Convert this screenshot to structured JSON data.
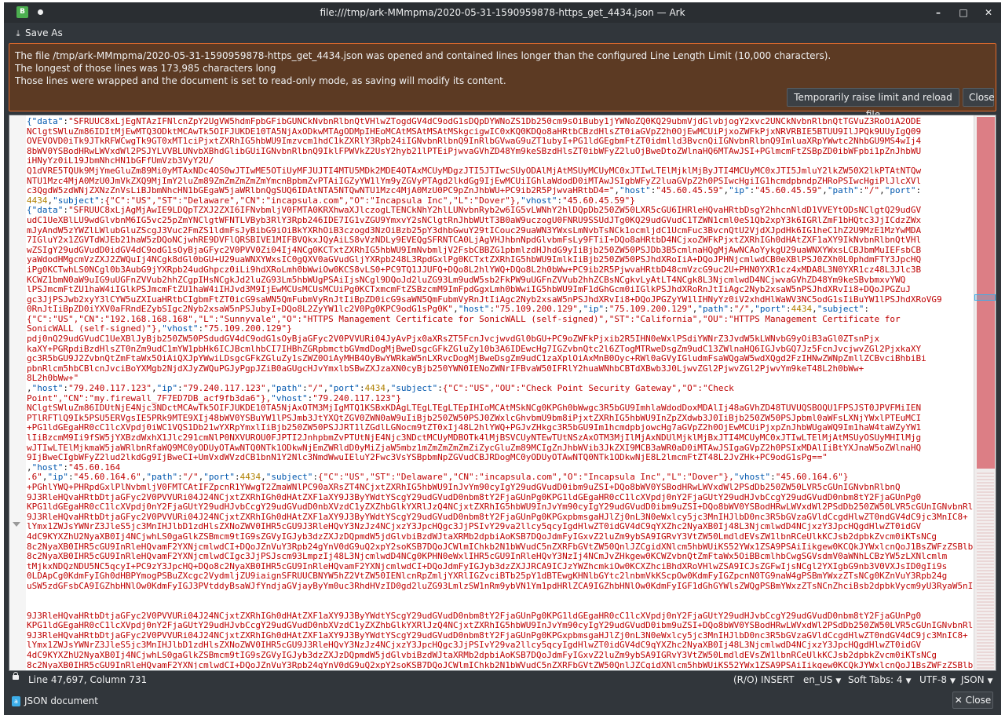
{
  "window": {
    "title": "file:///tmp/ark-MMmpma/2020-05-31-1590959878-https_get_4434.json — Ark",
    "app_icon": "B",
    "buttons": {
      "minimize": "–",
      "maximize": "□",
      "close": "✕"
    }
  },
  "toolbar": {
    "save_as": "Save As",
    "save_as_icon": "save-as-icon"
  },
  "banner": {
    "lines": [
      "The file /tmp/ark-MMmpma/2020-05-31-1590959878-https_get_4434.json was opened and contained lines longer than the configured Line Length Limit (10,000 characters).",
      "The longest of those lines was 173,985 characters long",
      "Those lines were wrapped and the document is set to read-only mode, as saving will modify its content."
    ],
    "reload_button": "Temporarily raise limit and reload file",
    "close_button": "Close",
    "colors": {
      "background": "#5c3a23",
      "border": "#e06a2c"
    }
  },
  "editor": {
    "lines": [
      [
        "{\"data\"",
        ":",
        "\"SFRUUC8xLjEgNTAzIFNlcnZpY2UgVW5hdmFpbGFibGUNCkNvbnRlbnQtVHlwZTogdGV4dC9odG1sDQpDYWNoZS1Db250cm9sOiBuby1jYWNoZQ0KQ29ubmVjdGlvbjogY2xvc2UNCkNvbnRlbnQtTGVuZ3RoOiA2ODE"
      ],
      [
        "",
        "",
        "NClgtSWluZm86IDItMjEwMTQ3ODktMCAwTk5OIFJUKDE10TA5NjAxODkwMTAgODMpIHEoMCAtMSAtMSAtMSkgcigwIC0xKQ0KDQo8aHRtbCBzdHlsZT0iaGVpZ2h0OjEwMCUiPjxoZWFkPjxNRVRBIE5BTUU9IlJPQk9UUyIgQ09"
      ],
      [
        "",
        "",
        "OVEVOVD0iTk9JTkRFWCwgTk9GT0xMT1ciPjxtZXRhIG5hbWU9Imzvcm1hdC1kZXRlY3Rpb24iIGNvbnRlbnQ9InRlbGVwaG9uZT1ubyI+PG1ldGEgbmFtZT0idmlld3BvcnQiIGNvbnRlbnQ9ImluaXRpYWwtc2NhbGU9MS4wIj4"
      ],
      [
        "",
        "",
        "8bWV0YSBodHRwLWVxdWl2PSJYLVVBLUNvbXBhdGlibGUiIGNvbnRlbnQ9IklFPWVkZ2UsY2hyb21lPTEiPjwvaGVhZD48Ym9keSBzdHlsZT0ibWFyZ2luOjBweDtoZWlnaHQ6MTAwJSI+PGlmcmFtZSBpZD0ibWFpbi1pZnJhbWU"
      ],
      [
        "",
        "",
        "iHNyYz0iL19JbmNhcHN1bGFfUmVzb3VyY2U/"
      ],
      [
        "",
        "",
        "Q1dVRE5TQUk9MjYmeGluZm89Mi0yMTAxNDc4OS0wJTIwME5OTiUyMFJUJTI4MTU5MDk2MDE4OTAxMCUyMDgzJTI5JTIwcSUyODAlMjAtMSUyMCUyMC0xJTIwLTElMjklMjByJTI4MCUyMC0xJTI5JmluY2lkZW50X2lkPTAtNTQw"
      ],
      [
        "",
        "",
        "NTU1Mzc4MjA0MzU0JmVkZXQ9MjImY2luZm89ZmZmZmZmZmYmcnBpbmZvPTAiIGZyYW1lYm9yZGVyPTAgd2lkdGg9IjEwMCUiIGhlaWdodD0iMTAwJSIgbWFyZ2luaGVpZ2h0PSIwcHgiIG1hcmdpbndpZHRoPSIwcHgiPlJlcXVl"
      ],
      [
        "",
        "",
        "c3QgdW5zdWNjZXNzZnVsLiBJbmNhcHN1bGEgaW5jaWRlbnQgSUQ6IDAtNTA5NTQwNTU1Mzc4MjA0MzU0PC9pZnJhbWU+PC9ib2R5PjwvaHRtbD4=\"",
        ",",
        ""
      ],
      [
        "",
        "",
        ""
      ],
      [
        "",
        "",
        ""
      ],
      [
        "{\"data\"",
        ":",
        "\"SFRUUC8xLjAgMjAwIE9LDQpTZXJ2ZXI6IFNvbmljV0FMTA0KRXhwaXJlczogLTENCkNhY2hlLUNvbnRyb2w6IG5vLWNhY2hlDQpDb250ZW50LXR5cGU6IHRleHQvaHRtbDsgY2hhcnNldD1VVEYtODsNClgtQ29udGV"
      ],
      [
        "",
        "",
        "udC1UeXBlLU9wdGlvbnM6IG5vc25pZmYNClgtWFNTLVByb3RlY3Rpb246IDE7IG1vZGU9YmxvY2sNClgtRnJhbWUtT3B0aW9uczogU0FNRU9SSUdJTg0KQ29udGVudC1TZWN1cml0eS1Qb2xpY3k6IGRlZmF1bHQtc3JjICdzZWx"
      ],
      [
        "",
        "",
        "mJyAndW5zYWZlLWlubGluZScgJ3Vuc2FmZS1ldmFsJyBibG9iOiBkYXRhOiB3czogd3NzOiBzb25pY3dhbGwuY29tICouc29uaWN3YWxsLmNvbTsNCk1ocmljdC1UcmFuc3BvcnQtU2VjdXJpdHk6IG1heC1hZ2U9MzE1MzYwMDA"
      ],
      [
        "",
        "",
        "7IGluY2x1ZGVTdWJEb21haW5zDQoNCjwhRE9DVFlQRSBIVE1MIFBVQkxJQyAiLS8vVzNDLy9EVEQgSFRNTCA0LjAgVHJhbnNpdGlvbmFsLy9FTiI+DQo8aHRtbD4NCjxoZWFkPjxtZXRhIGh0dHAtZXF1aXY9IkNvbnRlbnQtVHl"
      ],
      [
        "",
        "",
        "wZSIgY29udGVudD0idGV4dC9odG1sOyBjaGFyc2V0PVV0Zi04Ij4NCg0KCTxtZXRhIG5hbWU9ImNvbmljV2FsbCBBZG1pbmlzdHJhdG9yIiBjb250ZW50PSJDb3B5cmlnaHQgMjAwNCAoYykgU29uaWNXYWxsLCBJbmMuIEFsbCB"
      ],
      [
        "",
        "",
        "yaWdodHMgcmVzZXJ2ZWQuIj4NCgk8dGl0bGU+U29uaWNXYWxsIC0gQXV0aGVudGljYXRpb248L3RpdGxlPg0KCTxtZXRhIG5hbWU9ImlkIiBjb250ZW50PSJhdXRoIiA+DQoJPHNjcmlwdCB0eXBlPSJ0ZXh0L0phdmFTY3JpcHQ"
      ],
      [
        "",
        "",
        "iPg0KCTwhLS0NCgl0b3AubG9jYXRpb24udGhpcz0iLi9hdXRoLmh0bWwiOw0KCS8vLS0+PC9TQ1JJUFQ+DQo8L2hlYWQ+DQo8L2h0bWw+PC9ib2R5PjwvaHRtbD48cmVzcG9uc2U+PHN0YXR1cz4xMDA8L3N0YXR1cz48L3Jlc3B"
      ],
      [
        "",
        "",
        "KCWZ1bmN0aW9uIG9uUGFnZVVub2hhZCgpIHsNCgkJd2luZG93Lm5hbWUgPSAiIjsNCgl9DQoJd2luZG93Lm9udW5sb2FkPW9uUGFnZVVub2hhZCBsNCgkvLyAtLT4NCgk8L3NjcmlwdD4NCjwvaGVhZD48Ym9keSBvbmxvYWQ"
      ],
      [
        "",
        "",
        "lPSJmcmFtZU1haW4iIGlkPSJmcmFtZU1haW4iIHJvd3M9IjEwMCUsMCUsMCUiPg0KCTxmcmFtZSBzcmM9ImFpdGgxLmh0bWwiIG5hbWU9ImF1dGhGcm0iIGlkPSJhdXRoRnJtIiAgc2Nyb2xsaW5nPSJhdXRvIi8+DQoJPGZuJ"
      ],
      [
        "",
        "",
        "gc3JjPSJwb2xyY3lCYW5uZXIuaHRtbCIgbmFtZT0icG9saWN5QmFubmVyRnJtIiBpZD0icG9saWN5QmFubmVyRnJtIiAgc2Nyb2xsaW5nPSJhdXRvIi8+DQoJPGZyYW1lIHNyYz0iV2xhdHlWaWV3NC5odG1sIiBuYW1lPSJhdXRoVG9"
      ],
      [
        "",
        "",
        "0RnJtIiBpZD0iYXV0aFRndEZybSIgc2Nyb2xsaW5nPSJubyI+DQo8L2ZyYW1lc2V0Pg0KPC9odG1sPg0K\"",
        ",",
        ""
      ],
      [
        "",
        "",
        ""
      ],
      [
        "",
        "",
        ""
      ],
      [
        "",
        "",
        ""
      ],
      [
        "{\"data\"",
        ":",
        "\"SFRUUC8xLjAgMjAwIE9LDQpDb250ZW50LXR5cGU6IHRleHQvaHRtbAoKPGh0bWw+PGhlYWQ+PG1ldGEgaHR0cC1lcXVpdj0nQ29udGVudC1UeXBlJyBjb250ZW50PSdudGV4dC9odG1sOyBjaGFyc2V0PVVURi04JyAv"
      ],
      [
        "",
        "",
        "pdj0nQ29udGVudC1UeXBlJyBjb250ZW50PSdudGV4dC9odG1sOyBjaGFyc2V0PVVURi04JyAvPjx0aXRsZT5FcnJvcjwvdGl0bGU+PC9oZWFkPjxib2R5IHN0eWxlPSdiYWNrZ3JvdW5kLWNvbG9yOiB3aGl0ZTsnPjx"
      ],
      [
        "",
        "",
        "kaXY+PGRpdiBzdHlsZT0nZm9udC1mYW1pbHk6ICJBcmlhbCI7IHBhZGRpbmctbGVmdDogMjBweDsgcGFkZGluZy10b3A6IDEwcHg7IGZvbnQtc2l6ZTogMTRweDsgZm9udC13ZWlnaHQ6IGJvbGQ7Jz5FcnJvcjwvZGl2PjxkaXY"
      ],
      [
        "",
        "",
        "gc3R5bGU9J2ZvbnQtZmFtaWx5OiAiQXJpYWwiLDsgcGFkZGluZy1sZWZ0OiAyMHB4OyBwYWRkaW5nLXRvcDogMjBweDsgZm9udC1zaXplOiAxMnB0Oyc+RWl0aGVyIGludmFsaWQgaW5wdXQgd2FzIHNwZWNpZmllZCBvciBhbiBi"
      ],
      [
        "",
        "",
        "pbnRlcm5hbCBlcnJvciBoYXMgb2NjdXJyZWQuPGJyPgpJZiB0aGUgcHJvYmxlbSBwZXJzaXN0cyBjb250YWN0IENoZWNrIFBvaW50IFRlY2huaWNhbCBTdXBwb3J0LjwvZGl2PjwvZGl2PjwvYm9keT48L2h0bWw+"
      ],
      [
        "",
        "",
        "8L2h0bWw+\"",
        ",",
        ""
      ],
      [
        "",
        "",
        ""
      ],
      [
        "",
        "",
        ""
      ],
      [
        "{\"data\"",
        ":",
        "\"SFRUUC8xLjEgNTAzIFNlcnZpY2UgVW5hdmFpbGFibGUNCkNvbnRlbnQtVHlwZTogdGV4dC9odG1sDQpDYWNoZS1Db250cm9sOiBuby1jYWNoZQ0KQ29ubmVjdGlvbjogY2xvc2UNCkNvbnRlbnQtTGVuZ3RoOiA2ODE"
      ],
      [
        "",
        "",
        "NClgtSWluZm86IDUtNjE4Njc3NDctMCAwTk5OIFJUKDE10TA5NjAxOTM3MjIgMTQ1KSBxKDAgLTEgLTEgLTEpIHIoMCAtMSkNCg0KPGh0bWwgc3R5bGU9ImhlaWdodDoxMDAlIj48aGVhZD48TUVUQSBOQU1FPSJST0JPVFMiIEN"
      ],
      [
        "",
        "",
        "PTlRFTlQ9Ik5PSU5ERVgsIE5PRk9MTE9XIj48bWV0YSBuYW1lPSJmb3JtYXQtZGV0ZWN0aW9uIiBjb250ZW50PSJ0ZWxlcGhvbmU9bm8iPjxtZXRhIG5hbWU9InZpZXdwb3J0IiBjb250ZW50PSJpbml0aWFsLXNjYWxlPTEuMCI"
      ],
      [
        "",
        "",
        "+PG1ldGEgaHR0cC1lcXVpdj0iWC1VQS1Db21wYXRpYmxlIiBjb250ZW50PSJJRT1lZGdlLGNocm9tZT0xIj48L2hlYWQ+PGJvZHkgc3R5bGU9Im1hcmdpbjowcHg7aGVpZ2h0OjEwMCUiPjxpZnJhbWUgaWQ9Im1haW4taWZyYW1"
      ],
      [
        "",
        "",
        "lIiBzcmM9Ii9fSW5jYXBzdWxhX1Jlc291cmNlP0NXVUROU0FJPTI2JnhpbmZvPTUtNjE4Njc3NDctMCUyMDBOTk4lMjBSVCUyNTEwTUtNSzAxOTM3MjIlMjAxNDUlMjklMjBxJTI4MCUyMC0xJTIwLTElMjAtMSUyOSUyMHIlMjg"
      ],
      [
        "",
        "",
        "wJTIwLTElMjkmaW5jaWRlbnRfaWQ9MC0yODUyOTAwNTQ0NTk1ODkwNjEmZWRldD0yMiZjaW5mbz1mZmZmZmZmZiZycGluZm89MCIgZnJhbWVib3JkZXI9MCB3aWR0aD0iMTAwJSIgaGVpZ2h0PSIxMDAlIiBtYXJnaW5oZWlnaHQ"
      ],
      [
        "",
        "",
        "9IjBweCIgbWFyZ2lud2lkdGg9IjBweCI+UmVxdWVzdCB1bnN1Y2Nlc3NmdWwuIEluY2Fwc3VsYSBpbmNpZGVudCBJRDogMC0yODUyOTAwNTQ0NTk1ODkwNjE8L2lmcmFtZT48L2JvZHk+PC9odG1sPg==\"",
        ",",
        ""
      ],
      [
        "",
        "",
        ""
      ],
      [
        "",
        "",
        ""
      ],
      [
        "{\"data\"",
        ":",
        "\"SFRUUC8xLjAgMjAwIE9LDQpTZXJ2ZXI6IFNvbmljV0FMTA0KRXhwaXJlczogLTENCkNhY2hlLUNvbnRyb2w6IG5vLWNhY2hlDQpDb250ZW50LXR5cGU6IHRleHQvaHRtbDsgY2hhcnNldD1VVEYtODsNCg0KPGh0bWw"
      ],
      [
        "",
        "",
        "+PGhlYWQ+PHRpdGxlPlNvbmljV0FMTCAtIFZpcnR1YWwgT2ZmaWNlPC90aXRsZT4NCjxtZXRhIG5hbWU9InJvYm90cyIgY29udGVudD0ibm9uZSI+DQo8bWV0YSBodHRwLWVxdWl2PSdDb250ZW50LVR5cGUnIGNvbnRlbnQ"
      ],
      [
        "",
        "",
        "9J3RleHQvaHRtbDtjaGFyc2V0PVVURi04J24NCjxtZXRhIGh0dHAtZXF1aXY9J3ByYWdtYScgY29udGVudD0nbm8tY2FjaGUnPg0KPG1ldGEgaHR0cC1lcXVpdj0nY2FjaGUtY29udHJvbCcgY29udGVudD0nbm8tY2FjaGUnPg0"
      ],
      [
        "",
        "",
        "KPG1ldGEgaHR0cC1lcXVpdj0nY2FjaGUtY29udHJvbCcgY29udGVudD0nbXVzdC1yZXZhbGlkYXRlJzQ4NCjxtZXRhIG5hbWU9InJvYm90cyIgY29udGVudD0ibm9uZSI+DQo8bWV0YSBodHRwLWVxdWl2PSdDb250ZW50LVR5cGUnIGNvbnRlbnQ"
      ],
      [
        "",
        "",
        "9J3RleHQvaHRtbDtjaGFyc2V0PVVURi04J24NCjxtZXRhIGh0dHAtZXF1aXY9J3ByYWdtYScgY29udGVudD0nbm8tY2FjaGUnPg0KPGxpbmsgaHJlZj0nL3N0eWxlcy5jc3MnIHJlbD0nc3R5bGVzaGVldCcgdHlwZT0ndGV4dC9jc3MnIC8+"
      ],
      [
        "",
        "",
        "lYmx1ZWJsYWNrZ3JleS5jc3MnIHJlbD1zdHlsZXNoZWV0IHR5cGU9J3RleHQvY3NzJz4NCjxzY3JpcHQgc3JjPSIvY29va2llcy5qcyIgdHlwZT0idGV4dC9qYXZhc2NyaXB0Ij48L3NjcmlwdD4NCjxzY3JpcHQgdHlwZT0idGV"
      ],
      [
        "",
        "",
        "4dC9KYXZhU2NyaXB0Ij4NCjwhLS0gaGlkZSBmcm9tIG9sZGVyIGJyb3dzZXJzDQpmdW5jdGlvbiBzdWJtaXRMb2dpbiAoKSB7DQoJdmFyIGxvZ2luZm9ybSA9IGRvY3VtZW50LmdldEVsZW1lbnRCeUlkKCJsb2dpbkZvcm0iKTsNCg"
      ],
      [
        "",
        "",
        "8c2NyaXB0IHR5cGU9InRleHQvamF2YXNjcmlwdCI+DQoJZnVuY3Rpb24gYnV0dG9uQ2xpY2soKSB7DQoJCWlmIChkb2N1bWVudC5nZXRFbGVtZW50QnlJZCgidXNlcm5hbWUiKS52YWx1ZSA9PSAiIikgew0KCQkJYWxlcnQoJ1BsZWFzZSBlbnRl"
      ],
      [
        "",
        "",
        "8c2NyaXB0IHR5cGU9InRleHQvamF2YXNjcmlwdCIgc3JjPSJscm93LmpzIj48L3NjcmlwdD4NCg0KPHN0eWxlIHR5cGU9InRleHQvY3NzIj4NCmJvZHkgew0KCWZvbnQtZmFtaWx5OiBBcmlhbCwgSGVsdmV0aWNhLCBzYW5zLXNlcmlm"
      ],
      [
        "",
        "",
        "tMjkxNDQzNDU5NC5qcyI+PC9zY3JpcHQ+DQo8c2NyaXB0IHR5cGU9InRleHQvamF2YXNjcmlwdCI+DQoJdmFyIGJyb3dzZXJJRCA9ICJzYWZhcmkiOw0KCXZhciBhdXRoVHlwZSA9ICJsZGFwIjsNCgl2YXIgbG9nb3V0VXJsID0gIi9s"
      ],
      [
        "",
        "",
        "0LDApCg0KdmFyIGh0dHBPYmogPSBuZXcgc2VydmljZU9iaignSFRUUCBNYW5hZ2VtZW50IENlcnRpZmljYXRlIGZvciBTb25pY1dBTEwgKHNlbGYtc2lnbmVkKScpOw0KdmFyIGZpcnN0TG9naW4gPSBmYWxzZTsNCg0KZnVuY3Rpb24g"
      ],
      [
        "",
        "",
        "uSW5zdGFsbCA9IGZhbHNlOw0KdmFyIGJ3PVtddyBsaWJfYndjaGVjayByYm0uc3RhdHVzID0gd2luZG93LmlzSW1nRm9ybVN1Ym1pdHRlZCA9IGZhbHNlOw0KdmFyIGF1dGhGYWlsZWQgPSBmYWxzZTsNCnZhciBsb2dpbkVycm9yU3RyaW5nID0gIiI7"
      ]
    ],
    "record_tail_1": {
      "host_key": "\"host\"",
      "host_val": "\"45.60.45.59\"",
      "ip_key": "\"ip\"",
      "ip_val": "\"45.60.45.59\"",
      "path_key": "\"path\"",
      "path_val": "\"/\"",
      "port_key": "\"port\"",
      "port_val": "4434",
      "subject_key": "\"subject\"",
      "subject_text": "{\"C\":\"US\",\"ST\":\"Delaware\",\"CN\":\"incapsula.com\",\"O\":\"Incapsula Inc\",\"L\":\"Dover\"},",
      "vhost_key": "\"vhost\"",
      "vhost_val": "\"45.60.45.59\"}"
    },
    "record_tail_2": {
      "host_val": "\"75.109.200.129\"",
      "ip_val": "\"75.109.200.129\"",
      "port_val": "4434",
      "subject_text": "{\"C\":\"US\",\"CN\":\"192.168.168.168\",\"L\":\"Sunnyvale\",\"O\":\"HTTPS Management Certificate for SonicWALL (self-signed)\",\"ST\":\"California\",\"OU\":\"HTTPS Management Certificate for",
      "subject_text_2": "SonicWALL (self-signed)\"},",
      "vhost_val": "\"75.109.200.129\"}"
    },
    "record_tail_3": {
      "host_val": "\"79.240.117.123\"",
      "ip_val": "\"79.240.117.123\"",
      "port_val": "4434",
      "subject_text": "{\"C\":\"US\",\"OU\":\"Check Point Security Gateway\",\"O\":\"Check",
      "subject_text_2": "Point\",\"CN\":\"my.firewall_7F7ED7DB_acf9fb3da6\"},",
      "vhost_val": "\"79.240.117.123\"}"
    },
    "record_tail_4": {
      "host_val": "\"45.60.164",
      "host_val_2": ".6\"",
      "ip_val": "\"45.60.164.6\"",
      "port_val": "4434",
      "subject_text": "{\"C\":\"US\",\"ST\":\"Delaware\",\"CN\":\"incapsula.com\",\"O\":\"Incapsula Inc\",\"L\":\"Dover\"},",
      "vhost_val": "\"45.60.164.6\"}"
    }
  },
  "status": {
    "position": "Line 47,697, Column 731",
    "mode": "(R/O) INSERT",
    "language": "en_US",
    "indent": "Soft Tabs: 4",
    "encoding": "UTF-8",
    "syntax": "JSON"
  },
  "bottom": {
    "document_label": "JSON document",
    "close_label": "Close",
    "close_icon": "✕"
  }
}
